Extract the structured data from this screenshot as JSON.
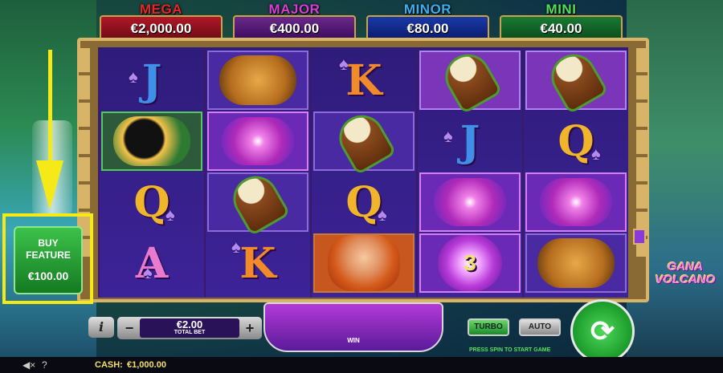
{
  "jackpots": [
    {
      "label": "MEGA",
      "value": "€2,000.00",
      "label_color": "#e8252a",
      "box_color": "#8a1020"
    },
    {
      "label": "MAJOR",
      "value": "€400.00",
      "label_color": "#d93cd8",
      "box_color": "#5a1a7a"
    },
    {
      "label": "MINOR",
      "value": "€80.00",
      "label_color": "#3ab0f0",
      "box_color": "#1a2a8a"
    },
    {
      "label": "MINI",
      "value": "€40.00",
      "label_color": "#4ee05a",
      "box_color": "#12602a"
    }
  ],
  "reels": [
    [
      "J",
      "jaguar",
      "drum",
      "drum",
      "drum"
    ],
    [
      "toucan",
      "orchid",
      "drum",
      "J",
      "Q"
    ],
    [
      "Q",
      "drum",
      "Q",
      "orchid",
      "orchid"
    ],
    [
      "A",
      "K",
      "woman",
      "orb-3",
      "jaguar"
    ]
  ],
  "symbols": {
    "r1c1": "J",
    "r1c3": "K",
    "r2c4": "J",
    "r2c5": "Q",
    "r3c1": "Q",
    "r3c3": "Q",
    "r4c1": "A",
    "r4c2": "K",
    "r4c4": "3"
  },
  "buy_feature": {
    "title_line1": "BUY",
    "title_line2": "FEATURE",
    "price": "€100.00"
  },
  "logo": {
    "line1": "GANA",
    "line2": "VOLCANO"
  },
  "controls": {
    "info": "i",
    "minus": "−",
    "plus": "+",
    "bet_value": "€2.00",
    "bet_label": "TOTAL BET",
    "win_label": "WIN",
    "turbo": "TURBO",
    "auto": "AUTO",
    "press_spin": "PRESS SPIN TO START GAME",
    "spin_glyph": "⟳"
  },
  "bottom": {
    "sound_icon": "◀×",
    "help_icon": "?",
    "cash_label": "CASH:",
    "cash_value": "€1,000.00"
  },
  "colors": {
    "highlight": "#f5ea18",
    "accent_green": "#1a9a2a"
  }
}
